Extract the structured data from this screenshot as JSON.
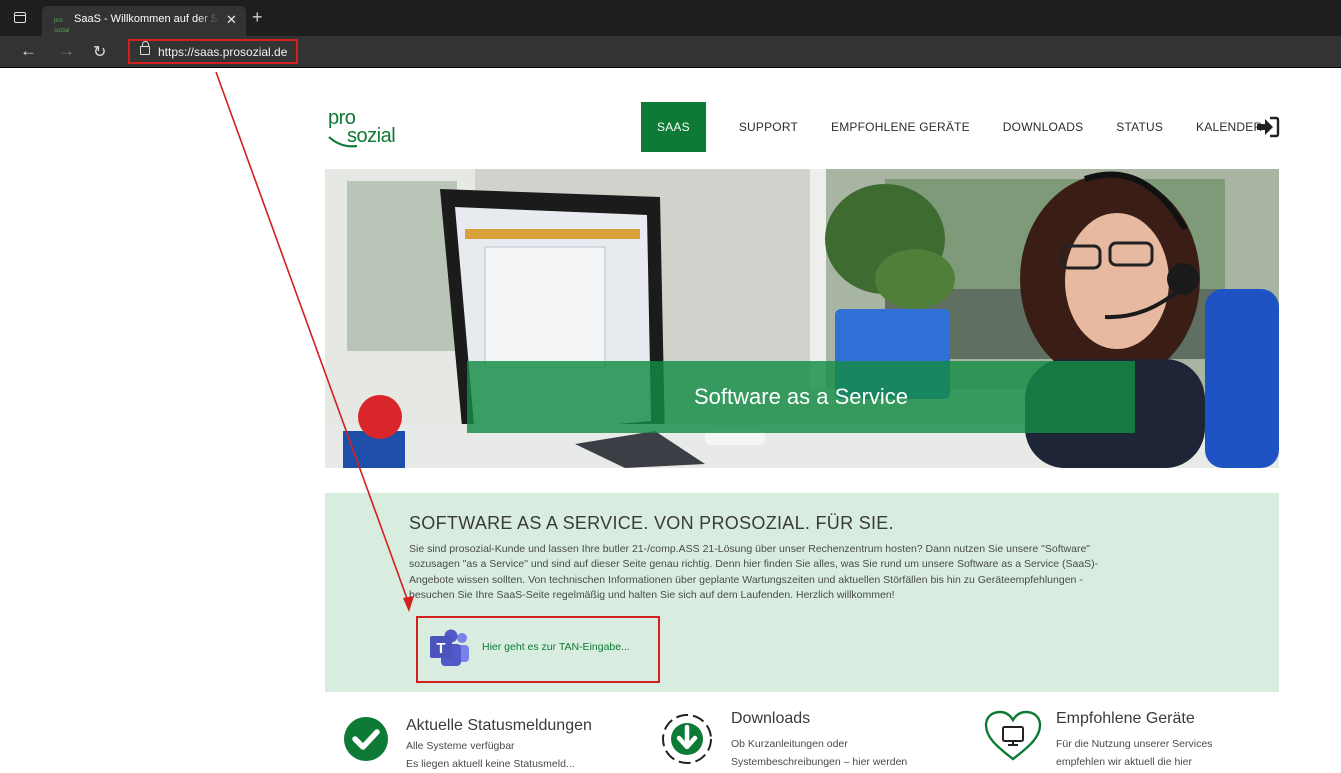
{
  "browser": {
    "tab_title": "SaaS - Willkommen auf der SaaS-Seite",
    "tab_favicon": "pro sozial",
    "close_glyph": "✕",
    "new_tab_glyph": "+",
    "back_glyph": "←",
    "forward_glyph": "→",
    "reload_glyph": "↻",
    "url": "https://saas.prosozial.de"
  },
  "site": {
    "logo": {
      "line1": "pro",
      "line2": "sozial"
    },
    "nav": {
      "items": [
        "SAAS",
        "SUPPORT",
        "EMPFOHLENE GERÄTE",
        "DOWNLOADS",
        "STATUS",
        "KALENDER"
      ],
      "active_index": 0
    },
    "hero": {
      "title": "Software as a Service"
    },
    "intro": {
      "title": "SOFTWARE AS A SERVICE. VON PROSOZIAL. FÜR SIE.",
      "lines": [
        "Sie sind prosozial-Kunde und lassen Ihre butler 21-/comp.ASS 21-Lösung über unser Rechenzentrum hosten? Dann nutzen Sie unsere \"Software\"",
        "sozusagen \"as a Service\" und sind auf dieser Seite genau richtig. Denn hier finden Sie alles, was Sie rund um unsere Software as a Service (SaaS)-",
        "Angebote wissen sollten. Von technischen Informationen über geplante Wartungszeiten und aktuellen Störfällen bis hin zu Geräteempfehlungen -",
        "besuchen Sie Ihre SaaS-Seite regelmäßig und halten Sie sich auf dem Laufenden. Herzlich willkommen!"
      ],
      "tan_link": "Hier geht es zur TAN-Eingabe...",
      "teams_letter": "T"
    },
    "features": [
      {
        "title": "Aktuelle Statusmeldungen",
        "lines": [
          "Alle Systeme verfügbar",
          "Es liegen aktuell keine Statusmeld..."
        ],
        "icon": "check-circle-icon"
      },
      {
        "title": "Downloads",
        "lines": [
          "Ob Kurzanleitungen oder",
          "Systembeschreibungen – hier werden"
        ],
        "icon": "download-icon"
      },
      {
        "title": "Empfohlene Geräte",
        "lines": [
          "Für die Nutzung unserer Services",
          "empfehlen wir aktuell die hier"
        ],
        "icon": "heart-monitor-icon"
      }
    ]
  },
  "colors": {
    "brand_green": "#0d7a35",
    "intro_bg": "#d8eddf",
    "highlight_red": "#d41f1f",
    "teams_purple": "#5059c9"
  }
}
